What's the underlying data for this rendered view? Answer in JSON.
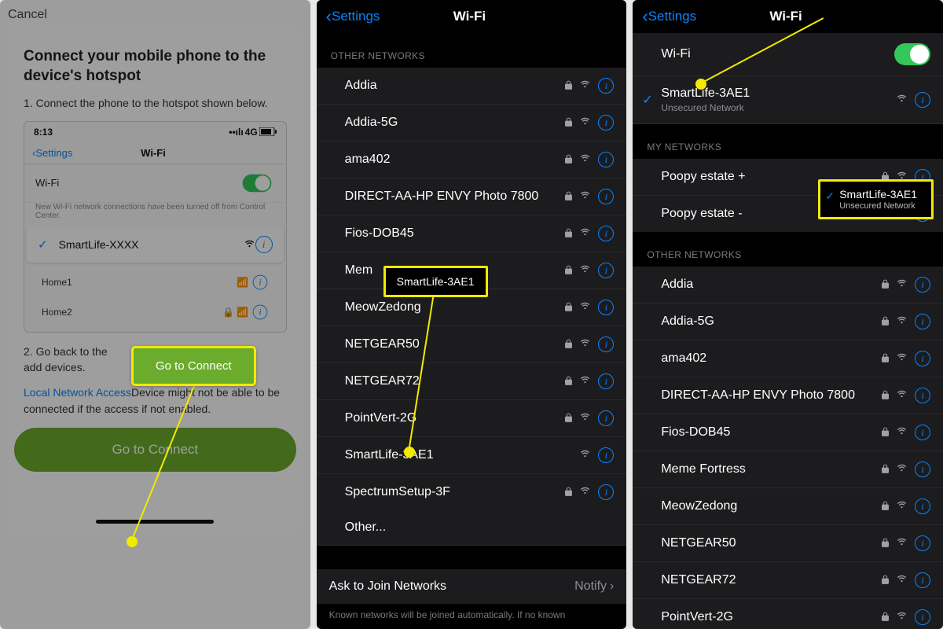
{
  "panel1": {
    "cancel": "Cancel",
    "heading": "Connect your mobile phone to the device's hotspot",
    "step1": "1. Connect the phone to the hotspot shown below.",
    "step2a": "2. Go back to the",
    "step2b": "add devices.",
    "linkText": "Local Network Access",
    "linkRest": "Device might not be able to be connected if the access if not enabled.",
    "bigButton": "Go to Connect",
    "calloutButton": "Go to Connect",
    "mock": {
      "time": "8:13",
      "signal": "4G",
      "back": "Settings",
      "title": "Wi-Fi",
      "wifiLabel": "Wi-Fi",
      "subnote": "New Wi-Fi network connections have been turned off from Control Center.",
      "selected": "SmartLife-XXXX",
      "items": [
        "Home1",
        "Home2"
      ]
    }
  },
  "panel2": {
    "back": "Settings",
    "title": "Wi-Fi",
    "sectionOther": "OTHER NETWORKS",
    "networks": [
      {
        "name": "Addia",
        "lock": true
      },
      {
        "name": "Addia-5G",
        "lock": true
      },
      {
        "name": "ama402",
        "lock": true
      },
      {
        "name": "DIRECT-AA-HP ENVY Photo 7800",
        "lock": true
      },
      {
        "name": "Fios-DOB45",
        "lock": true
      },
      {
        "name": "Mem",
        "lock": true
      },
      {
        "name": "MeowZedong",
        "lock": true
      },
      {
        "name": "NETGEAR50",
        "lock": true
      },
      {
        "name": "NETGEAR72",
        "lock": true
      },
      {
        "name": "PointVert-2G",
        "lock": true
      },
      {
        "name": "SmartLife-3AE1",
        "lock": false
      },
      {
        "name": "SpectrumSetup-3F",
        "lock": true
      }
    ],
    "other": "Other...",
    "askJoin": "Ask to Join Networks",
    "askVal": "Notify",
    "footnote": "Known networks will be joined automatically. If no known",
    "tooltip": "SmartLife-3AE1"
  },
  "panel3": {
    "back": "Settings",
    "title": "Wi-Fi",
    "wifiLabel": "Wi-Fi",
    "connected": {
      "name": "SmartLife-3AE1",
      "sub": "Unsecured Network"
    },
    "sectionMy": "MY NETWORKS",
    "myNetworks": [
      "Poopy estate +",
      "Poopy estate -"
    ],
    "sectionOther": "OTHER NETWORKS",
    "networks": [
      {
        "name": "Addia",
        "lock": true
      },
      {
        "name": "Addia-5G",
        "lock": true
      },
      {
        "name": "ama402",
        "lock": true
      },
      {
        "name": "DIRECT-AA-HP ENVY Photo 7800",
        "lock": true
      },
      {
        "name": "Fios-DOB45",
        "lock": true
      },
      {
        "name": "Meme Fortress",
        "lock": true
      },
      {
        "name": "MeowZedong",
        "lock": true
      },
      {
        "name": "NETGEAR50",
        "lock": true
      },
      {
        "name": "NETGEAR72",
        "lock": true
      },
      {
        "name": "PointVert-2G",
        "lock": true
      }
    ],
    "tooltip": {
      "name": "SmartLife-3AE1",
      "sub": "Unsecured Network"
    }
  }
}
